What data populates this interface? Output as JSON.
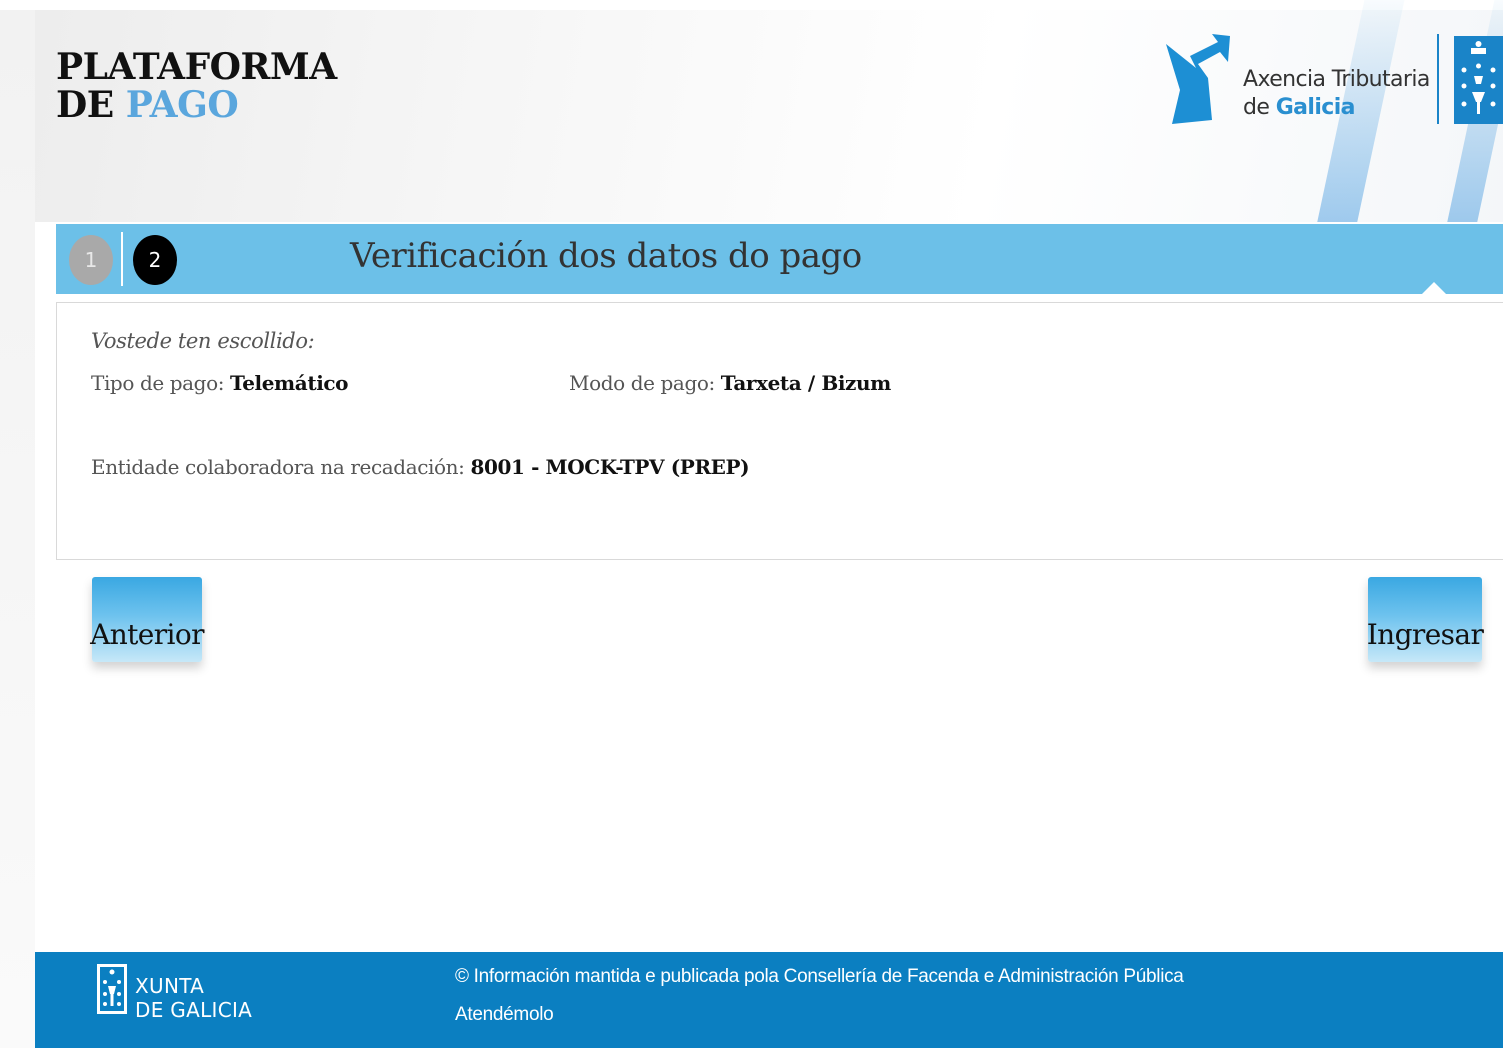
{
  "header": {
    "brand_line1": "PLATAFORMA",
    "brand_line2_de": "DE ",
    "brand_line2_pago": "PAGO",
    "agency_line1": "Axencia Tributaria",
    "agency_line2_de": "de ",
    "agency_line2_galicia": "Galicia",
    "agency_logo_icon": "atg-arrow-icon",
    "coat_of_arms_icon": "galicia-coat-of-arms-icon"
  },
  "steps": {
    "items": [
      {
        "number": "1",
        "state": "completed"
      },
      {
        "number": "2",
        "state": "active"
      }
    ],
    "title": "Verificación dos datos do pago"
  },
  "summary": {
    "chosen_label": "Vostede ten escollido:",
    "tipo_label": "Tipo de pago: ",
    "tipo_value": "Telemático",
    "modo_label": "Modo de pago: ",
    "modo_value": "Tarxeta / Bizum",
    "entidade_label": "Entidade colaboradora na recadación: ",
    "entidade_value": "8001 - MOCK-TPV (PREP)"
  },
  "buttons": {
    "previous_label": "Anterior",
    "submit_label": "Ingresar"
  },
  "footer": {
    "xunta_line1": "XUNTA",
    "xunta_line2": "DE GALICIA",
    "info": "© Información mantida e publicada pola Consellería de Facenda e Administración Pública",
    "contact_link": "Atendémolo"
  },
  "colors": {
    "accent": "#6cc0e8",
    "footer_bg": "#0b7fc1",
    "brand_blue": "#5aa6dd",
    "step_active": "#000000",
    "step_done": "#a9a9a9"
  }
}
